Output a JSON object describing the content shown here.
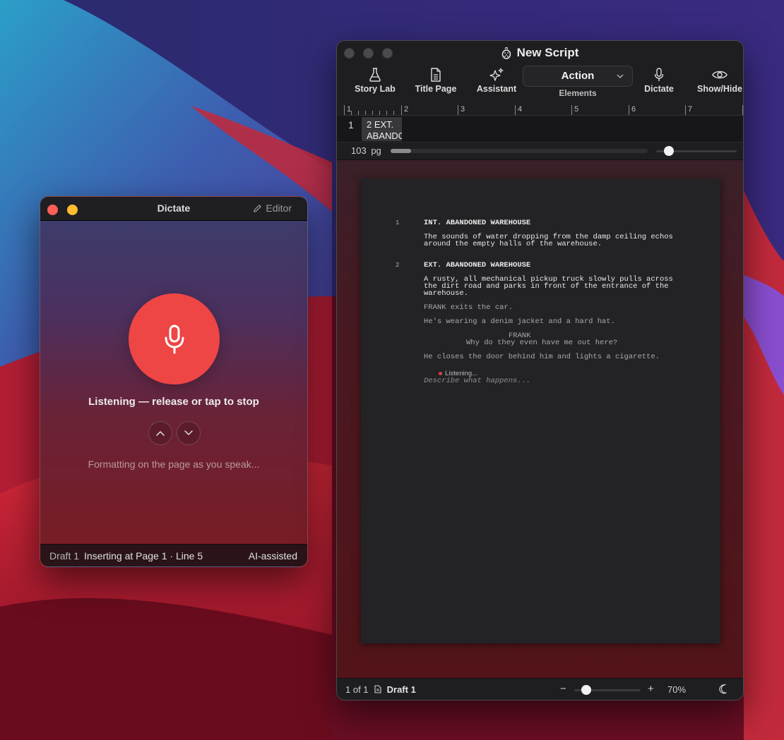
{
  "dictate_window": {
    "title": "Dictate",
    "editor_label": "Editor",
    "listening_text": "Listening — release or tap to stop",
    "formatting_text": "Formatting on the page as you speak...",
    "status": {
      "draft": "Draft 1",
      "insert_position": "Inserting at Page 1 · Line 5",
      "mode": "AI-assisted"
    }
  },
  "script_window": {
    "title": "New Script",
    "toolbar": {
      "story_lab": "Story Lab",
      "title_page": "Title Page",
      "assistant": "Assistant",
      "element_value": "Action",
      "element_label": "Elements",
      "dictate": "Dictate",
      "show_hide": "Show/Hide"
    },
    "ruler_labels": [
      "1",
      "2",
      "3",
      "4",
      "5",
      "6",
      "7"
    ],
    "scene_strip": {
      "current_number": "1",
      "card_line1": "2 EXT.",
      "card_line2": "ABANDONED"
    },
    "page_count": "103",
    "page_unit": "pg",
    "page_progress": 0.08,
    "scale_slider_value": 0.16,
    "page": {
      "scene1_number": "1",
      "scene1_heading": "INT. ABANDONED WAREHOUSE",
      "scene1_action_1": "The sounds of water dropping from the damp ceiling echos",
      "scene1_action_2": "around the empty halls of the warehouse.",
      "scene2_number": "2",
      "scene2_heading": "EXT. ABANDONED WAREHOUSE",
      "scene2_action_1": "A rusty, all mechanical pickup truck slowly pulls across",
      "scene2_action_2": "the dirt road and parks in front of the entrance of the",
      "scene2_action_3": "warehouse.",
      "action_frank_exits": "FRANK exits the car.",
      "action_wearing": "He's wearing a denim jacket and a hard hat.",
      "character": "FRANK",
      "dialogue": "Why do they even have me out here?",
      "action_closes": "He closes the door behind him and lights a cigarette.",
      "listening_indicator": "Listening...",
      "placeholder": "Describe what happens..."
    },
    "status": {
      "page_of": "1 of 1",
      "draft": "Draft 1",
      "zoom_minus": "−",
      "zoom_plus": "+",
      "zoom": "70%",
      "zoom_slider_value": 0.18
    }
  },
  "colors": {
    "record_red": "#ee4545",
    "close_red": "#ff5f57",
    "minimize_yellow": "#febc2e",
    "listening_dot": "#d94040"
  }
}
